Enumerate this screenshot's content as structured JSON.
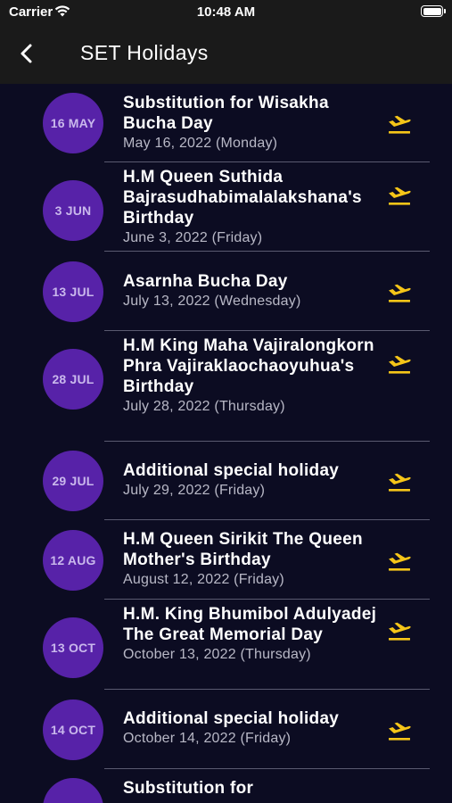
{
  "status_bar": {
    "carrier": "Carrier",
    "time": "10:48 AM",
    "wifi_icon": "wifi-icon",
    "battery_icon": "battery-icon"
  },
  "nav": {
    "back_icon": "chevron-left-icon",
    "title": "SET Holidays"
  },
  "colors": {
    "background": "#0c0c22",
    "bar": "#1a1a1a",
    "circle": "#5722a8",
    "icon": "#f5c518",
    "divider": "#5a5a70"
  },
  "holidays": [
    {
      "badge": "16 MAY",
      "title": "Substitution for Wisakha Bucha Day",
      "date": "May 16, 2022 (Monday)",
      "icon": "airplane-departure-icon"
    },
    {
      "badge": "3 JUN",
      "title": "H.M Queen Suthida Bajrasudhabimalalakshana's Birthday",
      "date": "June 3, 2022 (Friday)",
      "icon": "airplane-departure-icon"
    },
    {
      "badge": "13 JUL",
      "title": "Asarnha Bucha Day",
      "date": "July 13, 2022 (Wednesday)",
      "icon": "airplane-departure-icon"
    },
    {
      "badge": "28 JUL",
      "title": "H.M King Maha Vajiralongkorn Phra Vajiraklaochaoyuhua's Birthday",
      "date": "July 28, 2022 (Thursday)",
      "icon": "airplane-departure-icon"
    },
    {
      "badge": "29 JUL",
      "title": "Additional special holiday",
      "date": "July 29, 2022 (Friday)",
      "icon": "airplane-departure-icon"
    },
    {
      "badge": "12 AUG",
      "title": "H.M Queen Sirikit The Queen Mother's Birthday",
      "date": "August 12, 2022 (Friday)",
      "icon": "airplane-departure-icon"
    },
    {
      "badge": "13 OCT",
      "title": "H.M. King Bhumibol Adulyadej The Great Memorial Day",
      "date": "October 13, 2022 (Thursday)",
      "icon": "airplane-departure-icon"
    },
    {
      "badge": "14 OCT",
      "title": "Additional special holiday",
      "date": "October 14, 2022 (Friday)",
      "icon": "airplane-departure-icon"
    },
    {
      "badge": "",
      "title": "Substitution for",
      "date": "",
      "icon": ""
    }
  ]
}
